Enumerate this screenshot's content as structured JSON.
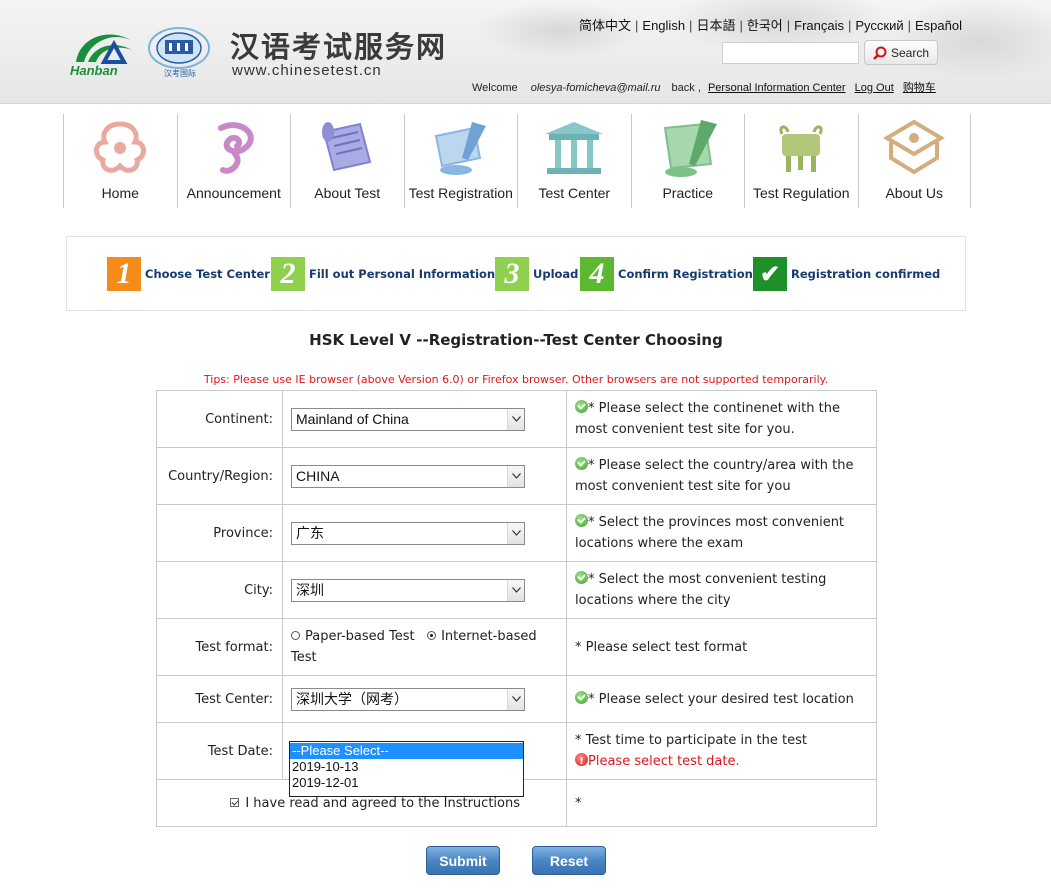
{
  "header": {
    "logo_left": "Hanban",
    "logo_right": "汉考国际",
    "site_title": "汉语考试服务网",
    "site_url": "www.chinesetest.cn",
    "languages": [
      "简体中文",
      "English",
      "日本語",
      "한국어",
      "Français",
      "Русский",
      "Español"
    ],
    "search_placeholder": "",
    "search_button": "Search",
    "welcome": "Welcome",
    "user_email": "olesya-fomicheva@mail.ru",
    "back": "back ,",
    "personal_center": "Personal Information Center",
    "logout": "Log Out",
    "cart": "购物车"
  },
  "nav": [
    {
      "label": "Home",
      "icon": "home-icon",
      "color": "#e9a9a0"
    },
    {
      "label": "Announcement",
      "icon": "announcement-icon",
      "color": "#c889c9"
    },
    {
      "label": "About Test",
      "icon": "about-test-icon",
      "color": "#8c8fd6"
    },
    {
      "label": "Test Registration",
      "icon": "test-registration-icon",
      "color": "#8ab7e0"
    },
    {
      "label": "Test Center",
      "icon": "test-center-icon",
      "color": "#86c7c7"
    },
    {
      "label": "Practice",
      "icon": "practice-icon",
      "color": "#7cc08a"
    },
    {
      "label": "Test Regulation",
      "icon": "test-regulation-icon",
      "color": "#b3c77a"
    },
    {
      "label": "About Us",
      "icon": "about-us-icon",
      "color": "#d3ad7e"
    }
  ],
  "steps": [
    {
      "num": "1",
      "label": "Choose Test Center",
      "color": "#f58c1a"
    },
    {
      "num": "2",
      "label": "Fill out Personal Information",
      "color": "#8fd14f"
    },
    {
      "num": "3",
      "label": "Upload",
      "color": "#8fd14f"
    },
    {
      "num": "4",
      "label": "Confirm Registration",
      "color": "#5bb82f"
    },
    {
      "num": "✔",
      "label": "Registration confirmed",
      "color": "#1f8f2a"
    }
  ],
  "page_title": "HSK Level Ⅴ --Registration--Test Center Choosing",
  "tips": "Tips: Please use IE browser (above Version 6.0) or Firefox browser. Other browsers are not supported temporarily.",
  "form": {
    "continent": {
      "label": "Continent:",
      "value": "Mainland of China",
      "hint": "* Please select the continenet with the most convenient test site for you."
    },
    "country": {
      "label": "Country/Region:",
      "value": "CHINA",
      "hint": "* Please select the country/area with the most convenient test site for you"
    },
    "province": {
      "label": "Province:",
      "value": "广东",
      "hint": "* Select the provinces most convenient locations where the exam"
    },
    "city": {
      "label": "City:",
      "value": "深圳",
      "hint": "* Select the most convenient testing locations where the city"
    },
    "format": {
      "label": "Test format:",
      "option1": "Paper-based Test",
      "option2": "Internet-based Test",
      "hint": "* Please select test format"
    },
    "center": {
      "label": "Test Center:",
      "value": "深圳大学（网考）",
      "hint": "* Please select your desired test location"
    },
    "date": {
      "label": "Test Date:",
      "options": [
        "--Please Select--",
        "2019-10-13",
        "2019-12-01"
      ],
      "hint": "* Test time to participate in the test",
      "error": "Please select test date."
    },
    "agree": {
      "label": "I have read and agreed to the Instructions",
      "hint": "*"
    }
  },
  "buttons": {
    "submit": "Submit",
    "reset": "Reset"
  }
}
